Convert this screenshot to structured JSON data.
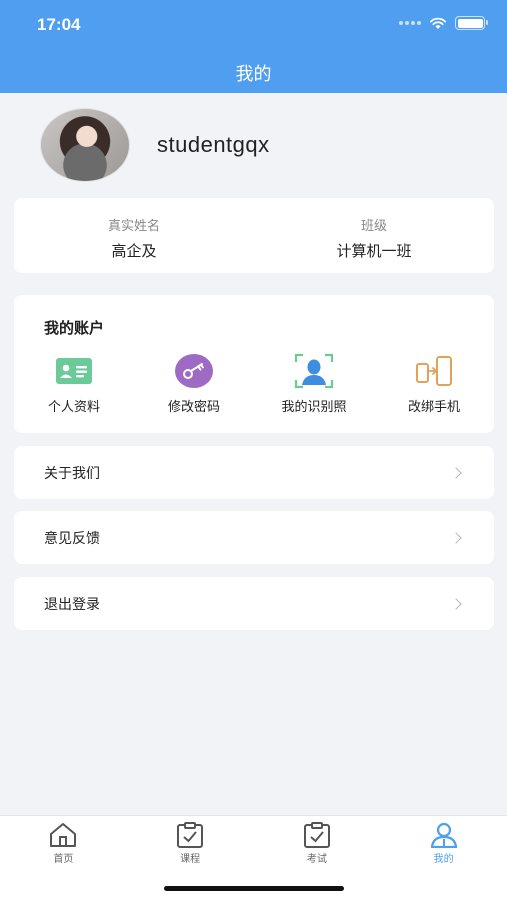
{
  "status_bar": {
    "time": "17:04"
  },
  "header": {
    "title": "我的"
  },
  "profile": {
    "username": "studentgqx"
  },
  "info": {
    "name_label": "真实姓名",
    "name_value": "高企及",
    "class_label": "班级",
    "class_value": "计算机一班"
  },
  "account": {
    "title": "我的账户",
    "items": [
      {
        "label": "个人资料",
        "icon": "id-card-icon"
      },
      {
        "label": "修改密码",
        "icon": "key-icon"
      },
      {
        "label": "我的识别照",
        "icon": "face-scan-icon"
      },
      {
        "label": "改绑手机",
        "icon": "phone-switch-icon"
      }
    ]
  },
  "menu": [
    {
      "label": "关于我们"
    },
    {
      "label": "意见反馈"
    },
    {
      "label": "退出登录"
    }
  ],
  "tabbar": {
    "items": [
      {
        "label": "首页",
        "icon": "home-icon"
      },
      {
        "label": "课程",
        "icon": "clipboard-check-icon"
      },
      {
        "label": "考试",
        "icon": "clipboard-check-icon"
      },
      {
        "label": "我的",
        "icon": "user-icon"
      }
    ],
    "active_index": 3
  },
  "colors": {
    "accent": "#4f9ef0",
    "background": "#f1f3f7",
    "id_card": "#6cc99a",
    "key": "#9d6bc4",
    "face": "#3d8de0",
    "phone": "#e1a35a"
  }
}
